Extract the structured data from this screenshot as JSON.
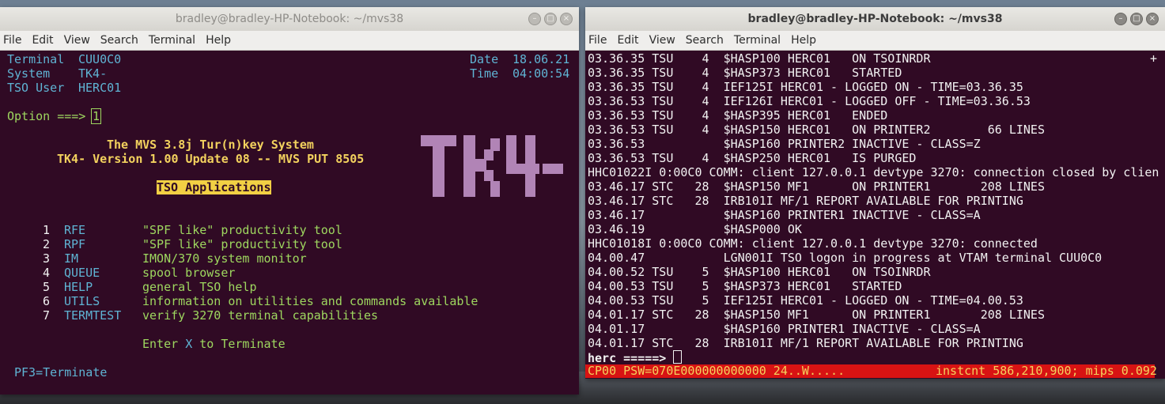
{
  "left_window": {
    "title": "bradley@bradley-HP-Notebook: ~/mvs38",
    "menu": [
      "File",
      "Edit",
      "View",
      "Search",
      "Terminal",
      "Help"
    ],
    "header": {
      "terminal_label": "Terminal",
      "terminal_value": "CUU0C0",
      "system_label": "System",
      "system_value": "TK4-",
      "tsouser_label": "TSO User",
      "tsouser_value": "HERC01",
      "date_label": "Date",
      "date_value": "18.06.21",
      "time_label": "Time",
      "time_value": "04:00:54"
    },
    "option_prompt": "Option ===>",
    "option_value": "1",
    "banner_line1": "The MVS 3.8j Tur(n)key System",
    "banner_line2": "TK4- Version 1.00 Update 08 -- MVS PUT 8505",
    "logo_text": "TK4-",
    "section_title": "TSO Applications",
    "apps": [
      {
        "num": "1",
        "name": "RFE",
        "desc": "\"SPF like\" productivity tool"
      },
      {
        "num": "2",
        "name": "RPF",
        "desc": "\"SPF like\" productivity tool"
      },
      {
        "num": "3",
        "name": "IM",
        "desc": "IMON/370 system monitor"
      },
      {
        "num": "4",
        "name": "QUEUE",
        "desc": "spool browser"
      },
      {
        "num": "5",
        "name": "HELP",
        "desc": "general TSO help"
      },
      {
        "num": "6",
        "name": "UTILS",
        "desc": "information on utilities and commands available"
      },
      {
        "num": "7",
        "name": "TERMTEST",
        "desc": "verify 3270 terminal capabilities"
      }
    ],
    "enter_pre": "Enter",
    "enter_x": "X",
    "enter_post": "to Terminate",
    "pf3": "PF3=Terminate"
  },
  "right_window": {
    "title": "bradley@bradley-HP-Notebook: ~/mvs38",
    "menu": [
      "File",
      "Edit",
      "View",
      "Search",
      "Terminal",
      "Help"
    ],
    "plus_marker": "+",
    "log_lines": [
      "03.36.35 TSU    4  $HASP100 HERC01   ON TSOINRDR",
      "03.36.35 TSU    4  $HASP373 HERC01   STARTED",
      "03.36.35 TSU    4  IEF125I HERC01 - LOGGED ON - TIME=03.36.35",
      "03.36.53 TSU    4  IEF126I HERC01 - LOGGED OFF - TIME=03.36.53",
      "03.36.53 TSU    4  $HASP395 HERC01   ENDED",
      "03.36.53 TSU    4  $HASP150 HERC01   ON PRINTER2        66 LINES",
      "03.36.53           $HASP160 PRINTER2 INACTIVE - CLASS=Z",
      "03.36.53 TSU    4  $HASP250 HERC01   IS PURGED",
      "HHC01022I 0:00C0 COMM: client 127.0.0.1 devtype 3270: connection closed by clien",
      "03.46.17 STC   28  $HASP150 MF1      ON PRINTER1       208 LINES",
      "03.46.17 STC   28  IRB101I MF/1 REPORT AVAILABLE FOR PRINTING",
      "03.46.17           $HASP160 PRINTER1 INACTIVE - CLASS=A",
      "03.46.19           $HASP000 OK",
      "HHC01018I 0:00C0 COMM: client 127.0.0.1 devtype 3270: connected",
      "04.00.47           LGN001I TSO logon in progress at VTAM terminal CUU0C0",
      "04.00.52 TSU    5  $HASP100 HERC01   ON TSOINRDR",
      "04.00.53 TSU    5  $HASP373 HERC01   STARTED",
      "04.00.53 TSU    5  IEF125I HERC01 - LOGGED ON - TIME=04.00.53",
      "04.01.17 STC   28  $HASP150 MF1      ON PRINTER1       208 LINES",
      "04.01.17           $HASP160 PRINTER1 INACTIVE - CLASS=A",
      "04.01.17 STC   28  IRB101I MF/1 REPORT AVAILABLE FOR PRINTING"
    ],
    "prompt": "herc =====>",
    "status_left": "CP00 PSW=070E000000000000 24..W.....",
    "status_right": "instcnt 586,210,900; mips 0.092"
  },
  "colors": {
    "terminal_bg": "#300a24",
    "cyan": "#5fb4d4",
    "green": "#9ed75f",
    "yellow": "#f3d25e",
    "logo": "#b184b6",
    "status_bar": "#d81313"
  },
  "icons": [
    "minimize-icon",
    "maximize-icon",
    "close-icon"
  ]
}
